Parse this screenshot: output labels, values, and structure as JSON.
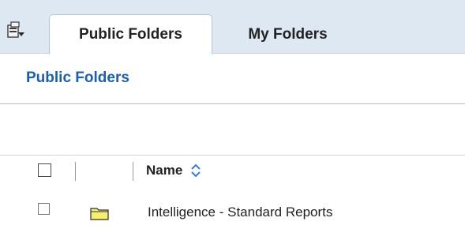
{
  "tabs": [
    {
      "label": "Public Folders",
      "active": true
    },
    {
      "label": "My Folders",
      "active": false
    }
  ],
  "breadcrumb": {
    "label": "Public Folders"
  },
  "table": {
    "columns": [
      {
        "label": "Name",
        "sortable": true
      }
    ],
    "rows": [
      {
        "name": "Intelligence - Standard Reports",
        "type": "folder",
        "checked": false
      }
    ]
  },
  "colors": {
    "tabbar_bg": "#dde8f2",
    "link": "#1a5fb4",
    "folder_fill": "#f7ef6e",
    "sort_icon": "#3a7bd5"
  },
  "icons": [
    "app-switcher-icon",
    "sort-icon",
    "folder-icon"
  ]
}
